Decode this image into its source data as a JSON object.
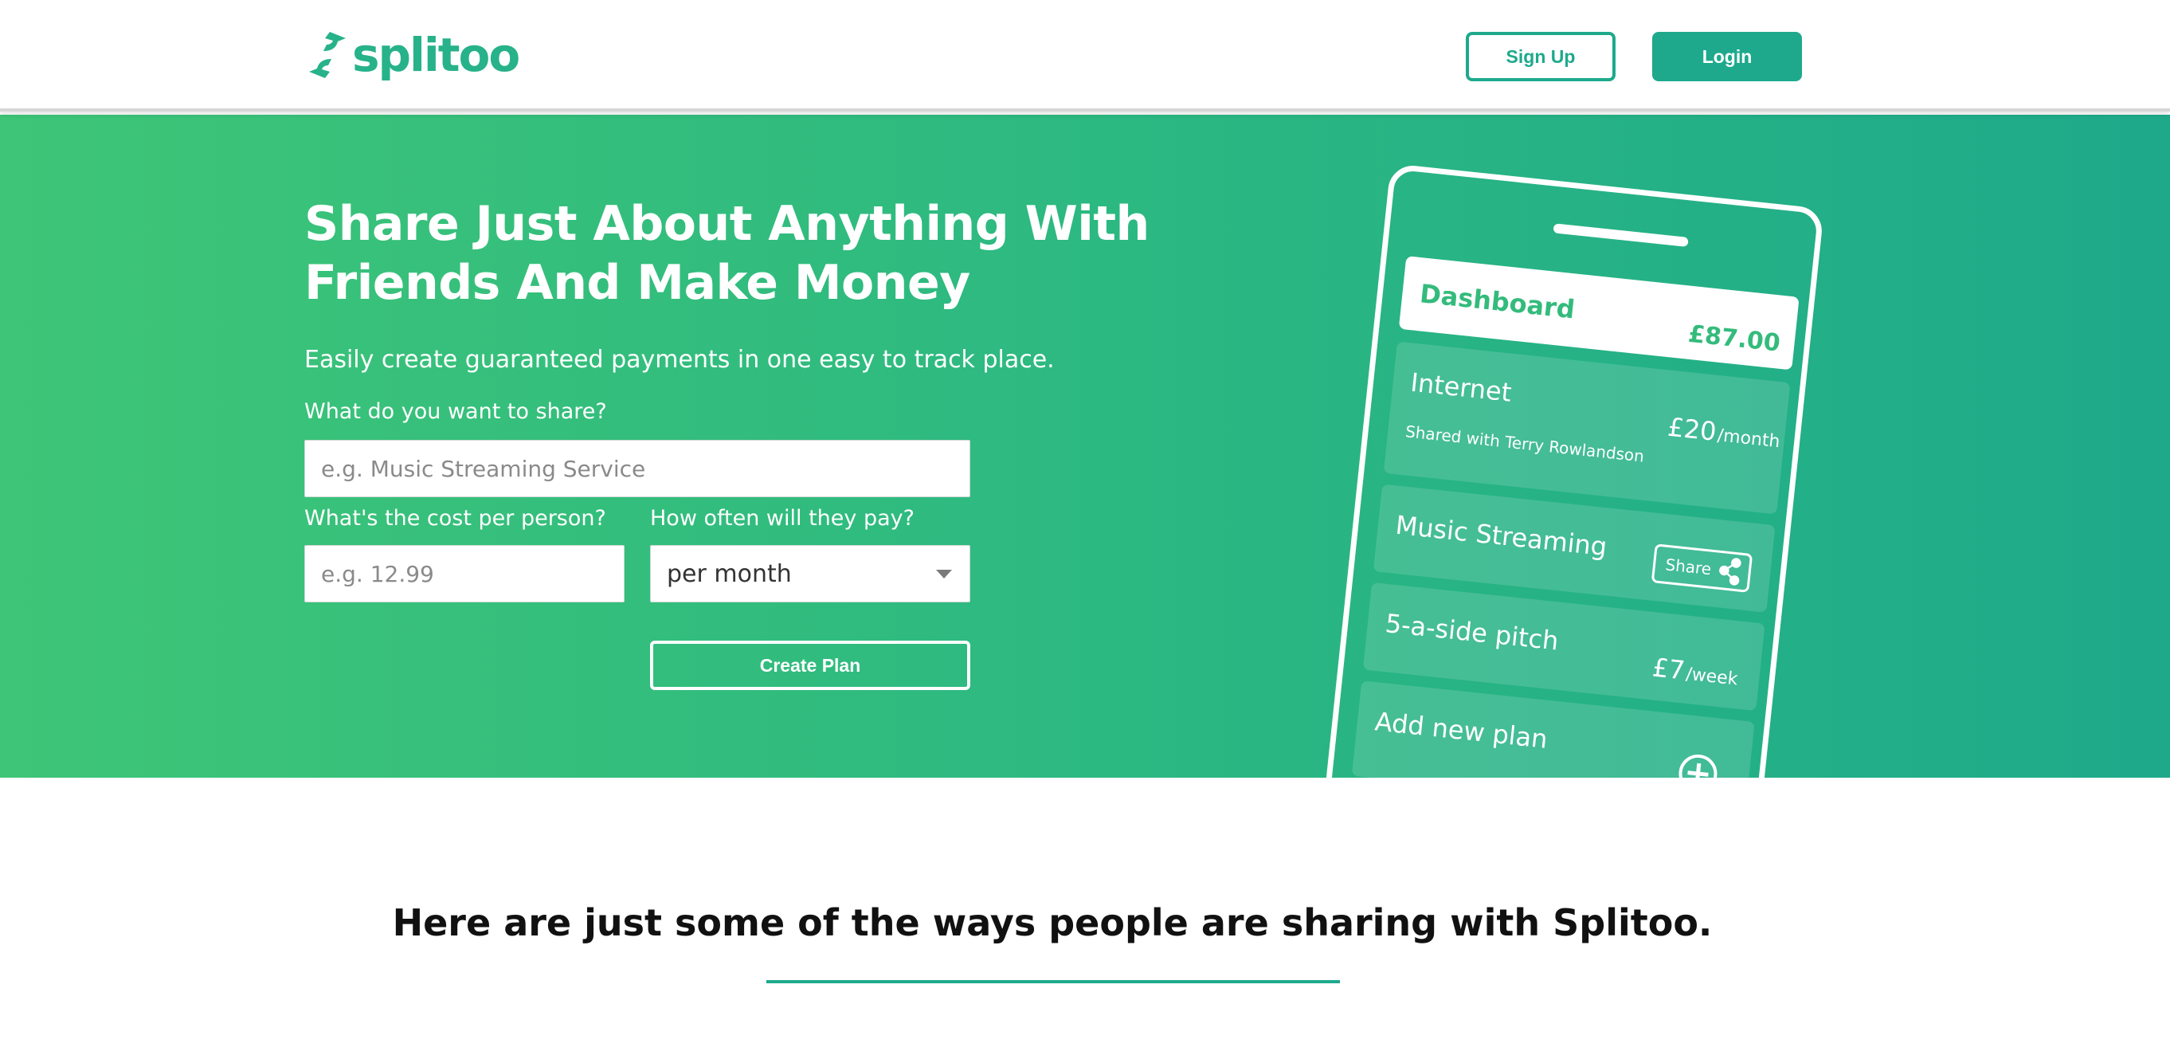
{
  "brand": {
    "name": "splitoo",
    "color": "#27b28a",
    "accent": "#1ea98c"
  },
  "header": {
    "signup_label": "Sign Up",
    "login_label": "Login"
  },
  "hero": {
    "title": "Share Just About Anything With Friends And Make Money",
    "subtitle": "Easily create guaranteed payments in one easy to track place.",
    "share_label": "What do you want to share?",
    "share_placeholder": "e.g. Music Streaming Service",
    "cost_label": "What's the cost per person?",
    "cost_placeholder": "e.g. 12.99",
    "frequency_label": "How often will they pay?",
    "frequency_value": "per month",
    "create_label": "Create Plan"
  },
  "phone": {
    "dashboard_label": "Dashboard",
    "dashboard_total": "£87.00",
    "plans": [
      {
        "name": "Internet",
        "detail": "Shared with Terry Rowlandson",
        "price": "£20",
        "unit": "/month"
      },
      {
        "name": "Music Streaming",
        "action": "Share"
      },
      {
        "name": "5-a-side pitch",
        "price": "£7",
        "unit": "/week"
      },
      {
        "name": "Add new plan"
      }
    ]
  },
  "section": {
    "title": "Here are just some of the ways people are sharing with Splitoo."
  }
}
